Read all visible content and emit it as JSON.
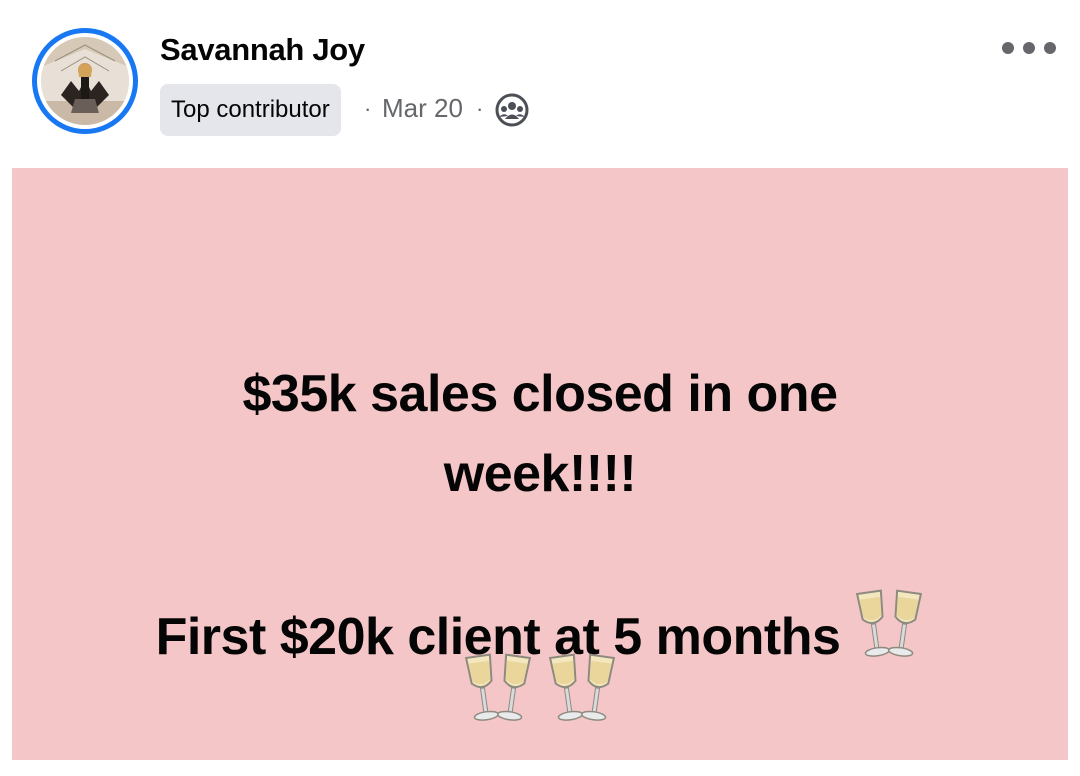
{
  "post": {
    "author": "Savannah Joy",
    "badge": "Top contributor",
    "date": "Mar 20",
    "separator": "·",
    "privacy_icon": "group-icon",
    "more_icon": "more-options-icon"
  },
  "content": {
    "background": "#f4c6c8",
    "line1": "$35k sales closed in one",
    "line2": "week!!!!",
    "line3": "First $20k client at 5 months",
    "emoji": "clinking-glasses-icon"
  },
  "colors": {
    "avatar_ring": "#1877f2",
    "badge_bg": "#e4e6eb",
    "meta_text": "#65676b"
  }
}
